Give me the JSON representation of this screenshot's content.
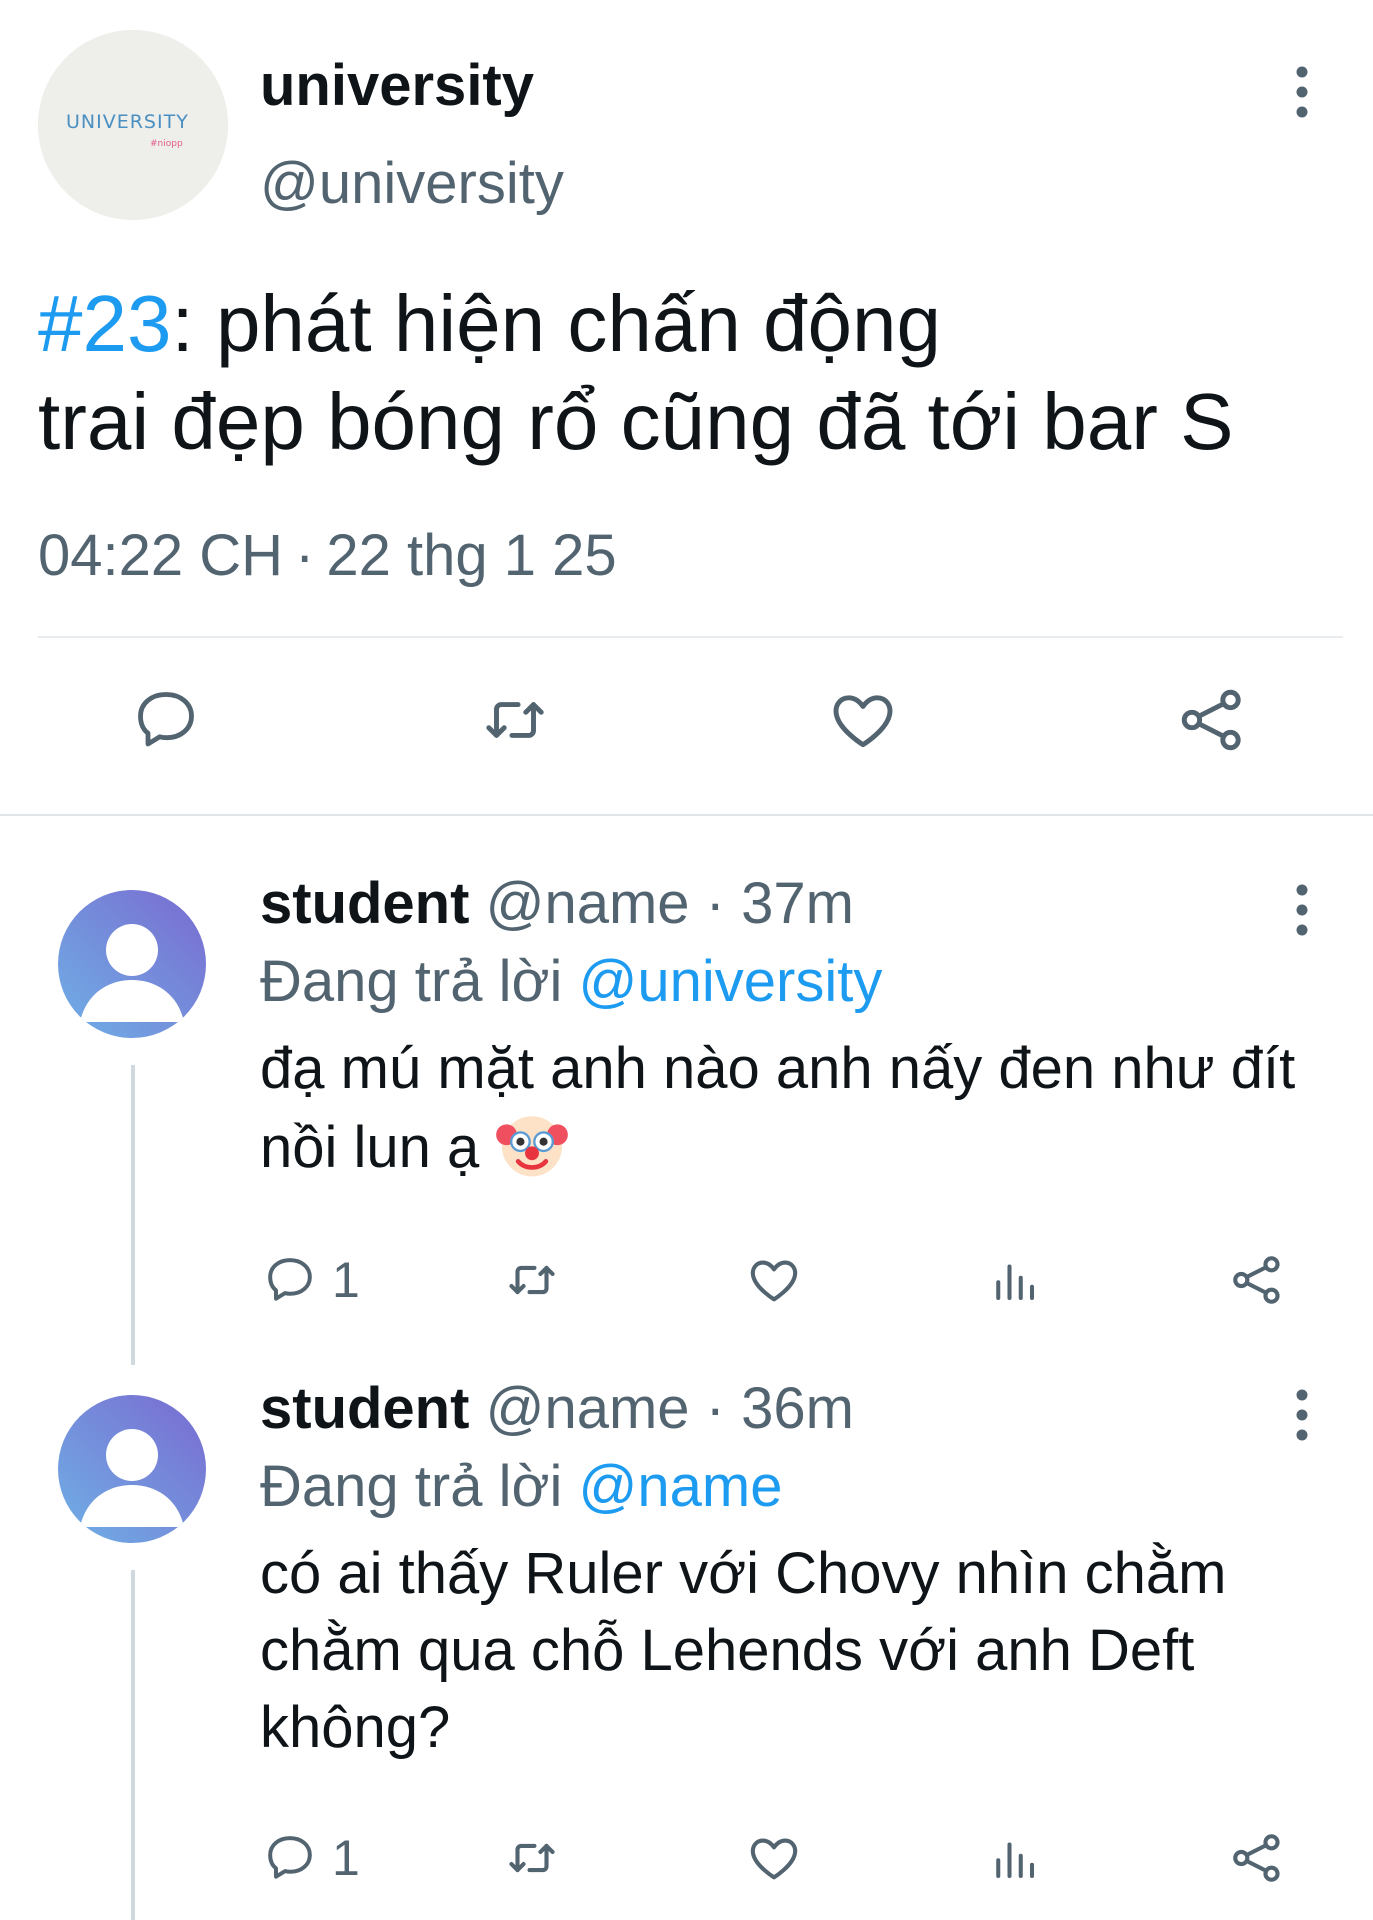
{
  "main_tweet": {
    "avatar_text": "UNIVERSITY",
    "avatar_subtext": "#niopp",
    "author_name": "university",
    "author_handle": "@university",
    "hashtag": "#23",
    "text_line1": ": phát hiện chấn động",
    "text_line2": "trai đẹp bóng rổ cũng đã tới bar S",
    "time": "04:22 CH",
    "separator": "·",
    "date": "22 thg 1 25",
    "actions": [
      "reply-icon",
      "retweet-icon",
      "like-icon",
      "share-icon"
    ]
  },
  "replies": [
    {
      "name": "student",
      "handle": "@name",
      "age": "· 37m",
      "replying_prefix": "Đang trả lời",
      "replying_to": "@university",
      "text": "đạ mú mặt anh nào anh nấy đen như đít nồi lun ạ",
      "emoji": "clown-face-emoji",
      "reply_count": "1"
    },
    {
      "name": "student",
      "handle": "@name",
      "age": "· 36m",
      "replying_prefix": "Đang trả lời",
      "replying_to": "@name",
      "text": "có ai thấy Ruler với Chovy nhìn chằm chằm qua chỗ Lehends với anh Deft không?",
      "reply_count": "1"
    }
  ],
  "colors": {
    "accent": "#1d9bf0",
    "secondary_text": "#536471",
    "avatar_gradient_start": "#6fb0e6",
    "avatar_gradient_end": "#7a6ad0"
  }
}
